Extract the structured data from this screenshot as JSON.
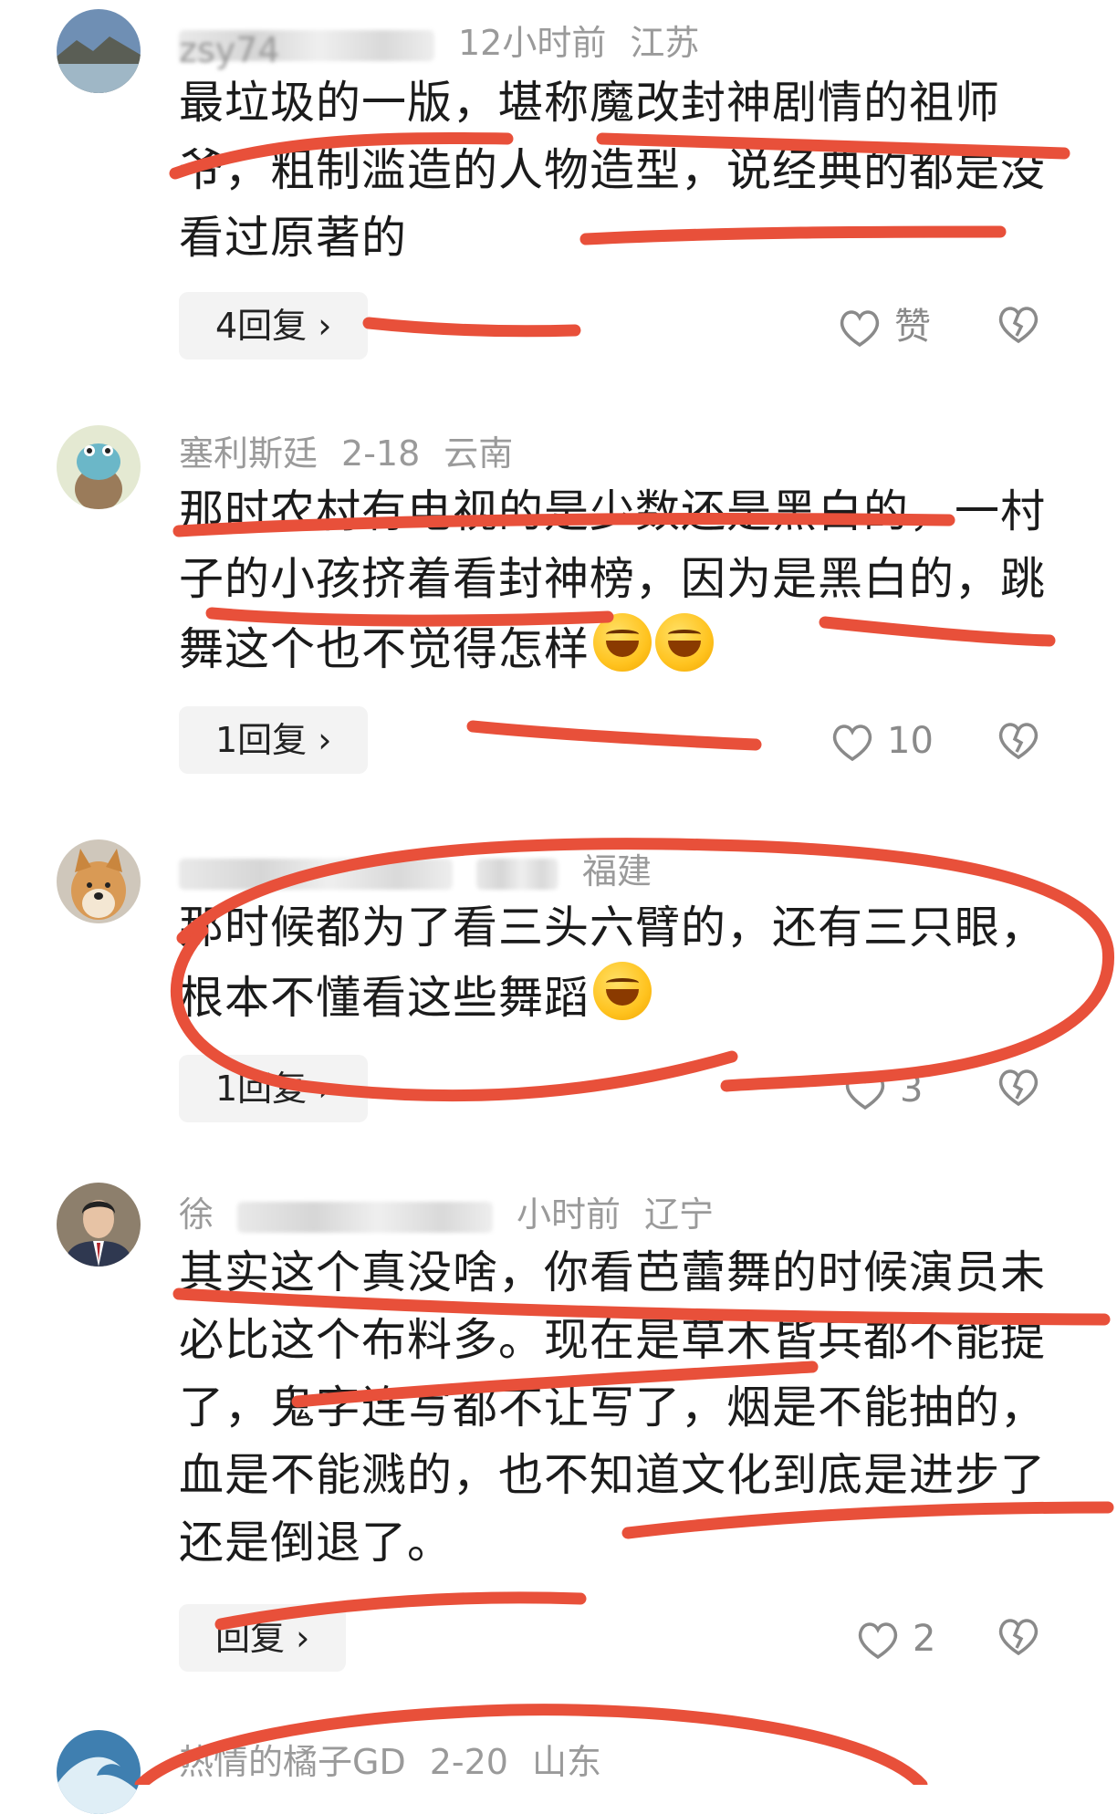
{
  "comments": [
    {
      "username": "zsy74",
      "time": "12小时前",
      "location": "江苏",
      "text": "最垃圾的一版，堪称魔改封神剧情的祖师爷，粗制滥造的人物造型，说经典的都是没看过原著的",
      "reply_label": "4回复",
      "like_label": "赞"
    },
    {
      "username": "塞利斯廷",
      "time": "2-18",
      "location": "云南",
      "text": "那时农村有电视的是少数还是黑白的，一村子的小孩挤着看封神榜，因为是黑白的，跳舞这个也不觉得怎样",
      "emojis": [
        "laughing-emoji",
        "laughing-emoji"
      ],
      "reply_label": "1回复",
      "like_label": "10"
    },
    {
      "username": "",
      "time": "",
      "location": "福建",
      "text": "那时候都为了看三头六臂的，还有三只眼，根本不懂看这些舞蹈",
      "emojis": [
        "crying-laughing-emoji"
      ],
      "reply_label": "1回复",
      "like_label": "3"
    },
    {
      "username": "徐",
      "time": "小时前",
      "location": "辽宁",
      "text": "其实这个真没啥，你看芭蕾舞的时候演员未必比这个布料多。现在是草木皆兵都不能提了，鬼字连写都不让写了，烟是不能抽的，血是不能溅的，也不知道文化到底是进步了还是倒退了。",
      "reply_label": "回复",
      "like_label": "2"
    },
    {
      "username": "热情的橘子GD",
      "time": "2-20",
      "location": "山东"
    }
  ],
  "colors": {
    "meta": "#9a9a9a",
    "annotation": "#e8503a",
    "reply_bg": "#f3f3f3"
  }
}
